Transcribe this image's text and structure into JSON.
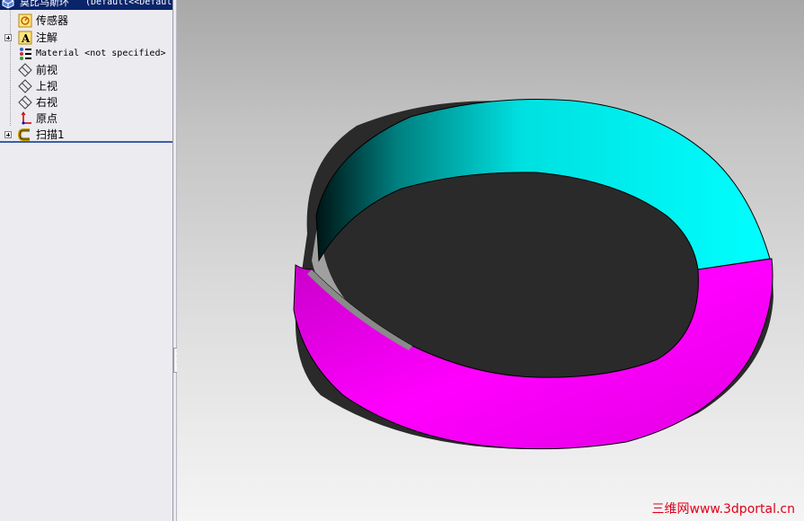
{
  "feature_tree": {
    "root": {
      "label": "莫比乌斯环",
      "config": "(Default<<Default",
      "icon": "part-icon"
    },
    "items": [
      {
        "label": "传感器",
        "icon": "sensor-icon",
        "expandable": false
      },
      {
        "label": "注解",
        "icon": "annotation-icon",
        "expandable": true
      },
      {
        "label": "Material <not specified>",
        "icon": "material-icon",
        "expandable": false
      },
      {
        "label": "前视",
        "icon": "plane-icon",
        "expandable": false
      },
      {
        "label": "上视",
        "icon": "plane-icon",
        "expandable": false
      },
      {
        "label": "右视",
        "icon": "plane-icon",
        "expandable": false
      },
      {
        "label": "原点",
        "icon": "origin-icon",
        "expandable": false
      },
      {
        "label": "扫描1",
        "icon": "sweep-feature-icon",
        "expandable": true
      }
    ]
  },
  "viewport": {
    "model": "mobius-strip",
    "colors": {
      "top_face": "#00ffff",
      "side_face": "#ff00ff",
      "background_top": "#a8a8a8",
      "background_bottom": "#f4f4f4"
    }
  },
  "watermark": "三维网www.3dportal.cn"
}
